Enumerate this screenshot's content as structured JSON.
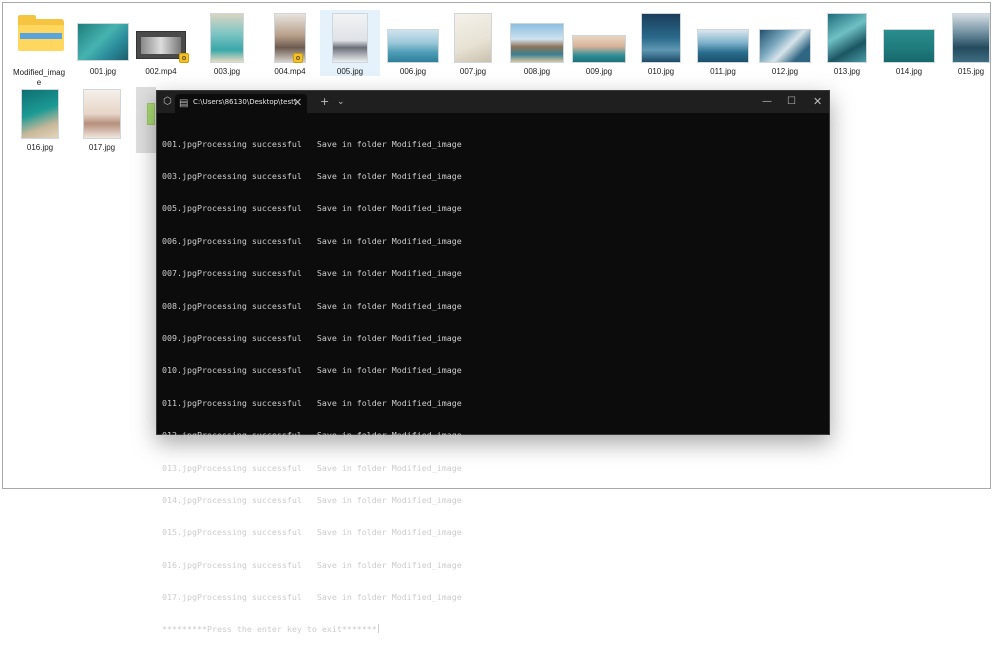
{
  "explorer": {
    "items": [
      {
        "name": "Modified_image",
        "type": "folder"
      },
      {
        "name": "001.jpg"
      },
      {
        "name": "002.mp4"
      },
      {
        "name": "003.jpg"
      },
      {
        "name": "004.mp4"
      },
      {
        "name": "005.jpg"
      },
      {
        "name": "006.jpg"
      },
      {
        "name": "007.jpg"
      },
      {
        "name": "008.jpg"
      },
      {
        "name": "009.jpg"
      },
      {
        "name": "010.jpg"
      },
      {
        "name": "011.jpg"
      },
      {
        "name": "012.jpg"
      },
      {
        "name": "013.jpg"
      },
      {
        "name": "014.jpg"
      },
      {
        "name": "015.jpg"
      },
      {
        "name": "016.jpg"
      },
      {
        "name": "017.jpg"
      }
    ]
  },
  "terminal": {
    "tab_title": "C:\\Users\\86130\\Desktop\\test\\",
    "lines": [
      "001.jpgProcessing successful   Save in folder Modified_image",
      "003.jpgProcessing successful   Save in folder Modified_image",
      "005.jpgProcessing successful   Save in folder Modified_image",
      "006.jpgProcessing successful   Save in folder Modified_image",
      "007.jpgProcessing successful   Save in folder Modified_image",
      "008.jpgProcessing successful   Save in folder Modified_image",
      "009.jpgProcessing successful   Save in folder Modified_image",
      "010.jpgProcessing successful   Save in folder Modified_image",
      "011.jpgProcessing successful   Save in folder Modified_image",
      "012.jpgProcessing successful   Save in folder Modified_image",
      "013.jpgProcessing successful   Save in folder Modified_image",
      "014.jpgProcessing successful   Save in folder Modified_image",
      "015.jpgProcessing successful   Save in folder Modified_image",
      "016.jpgProcessing successful   Save in folder Modified_image",
      "017.jpgProcessing successful   Save in folder Modified_image"
    ],
    "prompt": "*********Press the enter key to exit*******",
    "icons": {
      "shield": "shield-icon",
      "terminal": "terminal-icon",
      "close_tab": "close-icon",
      "new_tab": "plus-icon",
      "dropdown": "chevron-down-icon",
      "minimize": "minimize-icon",
      "maximize": "maximize-icon",
      "close": "close-icon"
    }
  }
}
